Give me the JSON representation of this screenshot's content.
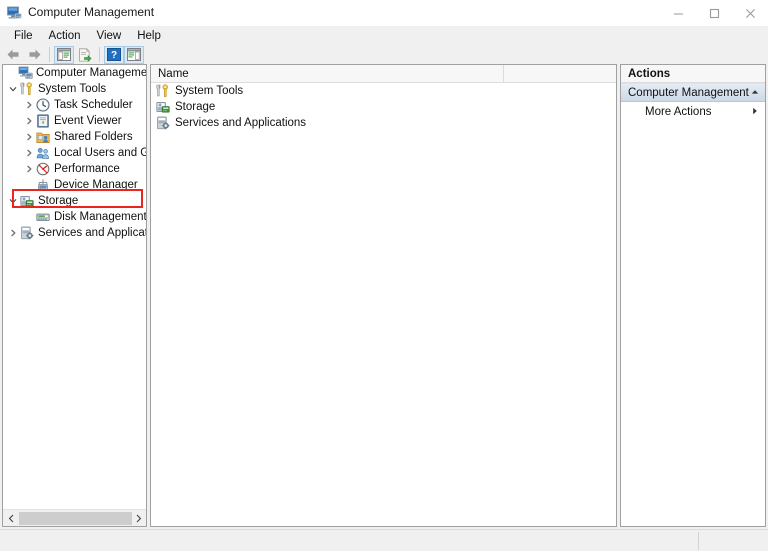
{
  "window": {
    "title": "Computer Management",
    "icon": "computer-management-icon",
    "controls": {
      "minimize": "minimize-icon",
      "maximize": "maximize-icon",
      "close": "close-icon"
    }
  },
  "menubar": {
    "items": [
      {
        "label": "File"
      },
      {
        "label": "Action"
      },
      {
        "label": "View"
      },
      {
        "label": "Help"
      }
    ]
  },
  "toolbar": {
    "items": [
      {
        "name": "back-arrow-icon",
        "kind": "arrow-left",
        "framed": false
      },
      {
        "name": "forward-arrow-icon",
        "kind": "arrow-right",
        "framed": false
      },
      {
        "name": "separator-1",
        "kind": "separator",
        "framed": false
      },
      {
        "name": "show-hide-console-tree-icon",
        "kind": "panel",
        "framed": true
      },
      {
        "name": "export-list-icon",
        "kind": "export",
        "framed": false
      },
      {
        "name": "separator-2",
        "kind": "separator",
        "framed": false
      },
      {
        "name": "help-icon",
        "kind": "help",
        "framed": true
      },
      {
        "name": "show-hide-action-pane-icon",
        "kind": "panel-green",
        "framed": true
      }
    ]
  },
  "tree": {
    "items": [
      {
        "label": "Computer Management (Local",
        "indent": 0,
        "chevron": "",
        "icon": "computer-icon",
        "selected": false
      },
      {
        "label": "System Tools",
        "indent": 1,
        "chevron": "expanded",
        "icon": "system-tools-icon",
        "selected": false
      },
      {
        "label": "Task Scheduler",
        "indent": 2,
        "chevron": "collapsed",
        "icon": "task-scheduler-icon",
        "selected": false
      },
      {
        "label": "Event Viewer",
        "indent": 2,
        "chevron": "collapsed",
        "icon": "event-viewer-icon",
        "selected": false
      },
      {
        "label": "Shared Folders",
        "indent": 2,
        "chevron": "collapsed",
        "icon": "shared-folders-icon",
        "selected": false
      },
      {
        "label": "Local Users and Groups",
        "indent": 2,
        "chevron": "collapsed",
        "icon": "local-users-groups-icon",
        "selected": false
      },
      {
        "label": "Performance",
        "indent": 2,
        "chevron": "collapsed",
        "icon": "performance-icon",
        "selected": false
      },
      {
        "label": "Device Manager",
        "indent": 2,
        "chevron": "",
        "icon": "device-manager-icon",
        "selected": false
      },
      {
        "label": "Storage",
        "indent": 1,
        "chevron": "expanded",
        "icon": "storage-icon",
        "selected": false
      },
      {
        "label": "Disk Management",
        "indent": 2,
        "chevron": "",
        "icon": "disk-management-icon",
        "selected": true
      },
      {
        "label": "Services and Applications",
        "indent": 1,
        "chevron": "collapsed",
        "icon": "services-applications-icon",
        "selected": false
      }
    ],
    "highlight_color": "#e8251f",
    "scrollbar": {
      "left_arrow": "chevron-left-icon",
      "right_arrow": "chevron-right-icon"
    }
  },
  "list": {
    "columns": [
      "Name"
    ],
    "rows": [
      {
        "name": "System Tools",
        "icon": "system-tools-icon"
      },
      {
        "name": "Storage",
        "icon": "storage-icon"
      },
      {
        "name": "Services and Applications",
        "icon": "services-applications-icon"
      }
    ]
  },
  "actions": {
    "header": "Actions",
    "selected": {
      "label": "Computer Management (L...",
      "chevron": "chevron-up-icon"
    },
    "rows": [
      {
        "label": "More Actions",
        "chevron": "chevron-right-icon"
      }
    ]
  },
  "statusbar": {
    "left_text": "",
    "right_text": ""
  },
  "colors": {
    "accent": "#cdd9e8",
    "highlight": "#e8251f",
    "panel_border": "#a0a0a0",
    "window_bg": "#f0f0f0"
  }
}
